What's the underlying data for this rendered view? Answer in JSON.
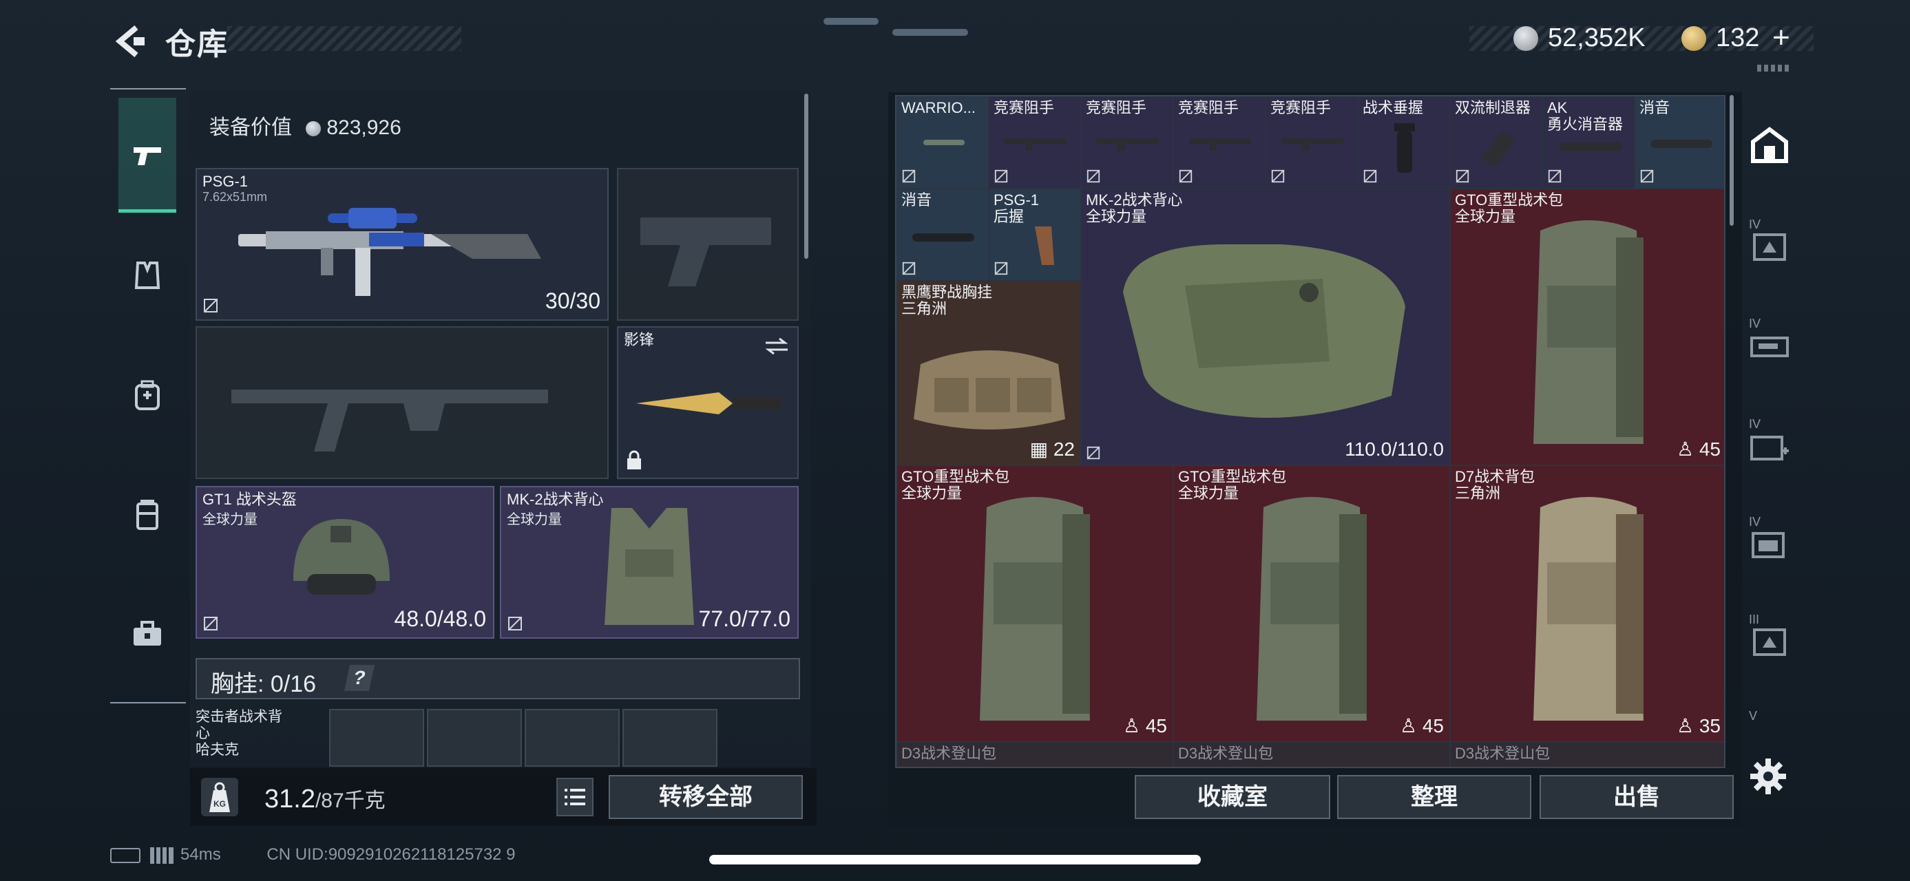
{
  "header": {
    "title": "仓库",
    "currency": {
      "silver": "52,352K",
      "gold": "132"
    }
  },
  "equipment": {
    "value_label": "装备价值",
    "value": "823,926",
    "primary": {
      "name": "PSG-1",
      "caliber": "7.62x51mm",
      "ammo": "30/30"
    },
    "melee": {
      "name": "影锋"
    },
    "helmet": {
      "name": "GT1 战术头盔",
      "brand": "全球力量",
      "durability": "48.0/48.0"
    },
    "armor": {
      "name": "MK-2战术背心",
      "brand": "全球力量",
      "durability": "77.0/77.0"
    },
    "chest_rig": {
      "label": "胸挂:",
      "count": "0/16",
      "help": "?"
    },
    "mini_slot_item": {
      "name": "突击者战术背心",
      "brand": "哈夫克"
    },
    "weight": {
      "current": "31.2",
      "max": "/87千克"
    },
    "transfer_all": "转移全部"
  },
  "inventory": {
    "row1": [
      {
        "name": "WARRIO..."
      },
      {
        "name": "竞赛阻手"
      },
      {
        "name": "竞赛阻手"
      },
      {
        "name": "竞赛阻手"
      },
      {
        "name": "竞赛阻手"
      },
      {
        "name": "战术垂握"
      },
      {
        "name": "双流制退器"
      },
      {
        "name": "AK\n勇火消音器"
      },
      {
        "name": "消音"
      }
    ],
    "row2_small": [
      {
        "name": "消音"
      },
      {
        "name": "PSG-1\n后握"
      }
    ],
    "vest": {
      "name": "MK-2战术背心\n全球力量",
      "durability": "110.0/110.0"
    },
    "backpack1": {
      "name": "GTO重型战术包\n全球力量",
      "capacity": "45"
    },
    "chestrig": {
      "name": "黑鹰野战胸挂\n三角洲",
      "capacity": "22"
    },
    "backpack2": {
      "name": "GTO重型战术包\n全球力量",
      "capacity": "45"
    },
    "backpack3": {
      "name": "GTO重型战术包\n全球力量",
      "capacity": "45"
    },
    "backpack4": {
      "name": "D7战术背包\n三角洲",
      "capacity": "35"
    },
    "row_bottom": [
      {
        "name": "D3战术登山包"
      },
      {
        "name": "D3战术登山包"
      },
      {
        "name": "D3战术登山包"
      }
    ]
  },
  "actions": {
    "collection": "收藏室",
    "sort": "整理",
    "sell": "出售"
  },
  "side_tabs": [
    "IV",
    "IV",
    "IV",
    "IV",
    "III",
    "V"
  ],
  "status": {
    "ping": "54ms",
    "uid": "CN UID:9092910262118125732 9"
  },
  "colors": {
    "accent": "#3fd1a6",
    "red_cell": "#4d1e28",
    "purple_cell": "#2e2c48",
    "blue_cell": "#2a3a4d"
  }
}
